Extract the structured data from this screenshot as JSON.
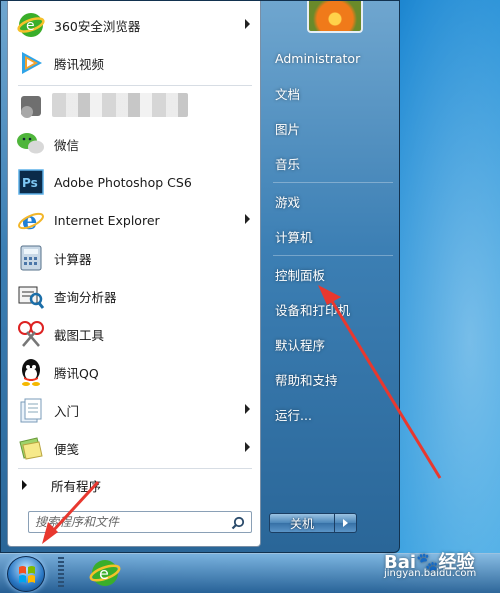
{
  "start_menu": {
    "programs": [
      {
        "label": "360安全浏览器",
        "icon": "360-browser-icon",
        "submenu": true
      },
      {
        "label": "腾讯视频",
        "icon": "tencent-video-icon",
        "submenu": false
      },
      {
        "label": "微信",
        "icon": "wechat-icon",
        "submenu": false
      },
      {
        "label": "Adobe Photoshop CS6",
        "icon": "photoshop-icon",
        "submenu": false
      },
      {
        "label": "Internet Explorer",
        "icon": "internet-explorer-icon",
        "submenu": true
      },
      {
        "label": "计算器",
        "icon": "calculator-icon",
        "submenu": false
      },
      {
        "label": "查询分析器",
        "icon": "query-analyzer-icon",
        "submenu": false
      },
      {
        "label": "截图工具",
        "icon": "snipping-tool-icon",
        "submenu": false
      },
      {
        "label": "腾讯QQ",
        "icon": "qq-icon",
        "submenu": false
      },
      {
        "label": "入门",
        "icon": "getting-started-icon",
        "submenu": true
      },
      {
        "label": "便笺",
        "icon": "sticky-notes-icon",
        "submenu": true
      }
    ],
    "all_programs": "所有程序",
    "search_placeholder": "搜索程序和文件",
    "right": {
      "user": "Administrator",
      "items": [
        "文档",
        "图片",
        "音乐",
        "游戏",
        "计算机",
        "控制面板",
        "设备和打印机",
        "默认程序",
        "帮助和支持",
        "运行..."
      ]
    },
    "shutdown_label": "关机"
  },
  "watermark": {
    "brand": "Bai",
    "brand_cn": "经验",
    "url": "jingyan.baidu.com"
  },
  "colors": {
    "accent": "#1c77c0",
    "annotation": "#e8382f"
  }
}
